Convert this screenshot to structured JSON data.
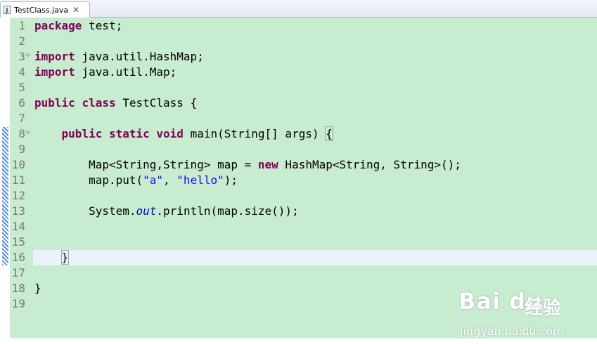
{
  "tab": {
    "title": "TestClass.java",
    "icon": "J",
    "close": "✕"
  },
  "lines": [
    {
      "no": "1",
      "tokens": [
        {
          "t": "package",
          "k": "kw"
        },
        {
          "t": " test;"
        }
      ]
    },
    {
      "no": "2",
      "tokens": []
    },
    {
      "no": "3",
      "fold": "⊖",
      "tokens": [
        {
          "t": "import",
          "k": "kw"
        },
        {
          "t": " java.util.HashMap;"
        }
      ]
    },
    {
      "no": "4",
      "tokens": [
        {
          "t": "import",
          "k": "kw"
        },
        {
          "t": " java.util.Map;"
        }
      ]
    },
    {
      "no": "5",
      "tokens": []
    },
    {
      "no": "6",
      "tokens": [
        {
          "t": "public",
          "k": "kw"
        },
        {
          "t": " "
        },
        {
          "t": "class",
          "k": "kw"
        },
        {
          "t": " TestClass {"
        }
      ]
    },
    {
      "no": "7",
      "tokens": []
    },
    {
      "no": "8",
      "fold": "⊖",
      "tokens": [
        {
          "t": "    "
        },
        {
          "t": "public",
          "k": "kw"
        },
        {
          "t": " "
        },
        {
          "t": "static",
          "k": "kw"
        },
        {
          "t": " "
        },
        {
          "t": "void",
          "k": "kw"
        },
        {
          "t": " main(String[] args) "
        },
        {
          "t": "{",
          "k": "bracket-box"
        }
      ]
    },
    {
      "no": "9",
      "tokens": []
    },
    {
      "no": "10",
      "tokens": [
        {
          "t": "        Map<String,String> map = "
        },
        {
          "t": "new",
          "k": "kw"
        },
        {
          "t": " HashMap<String, String>();"
        }
      ]
    },
    {
      "no": "11",
      "tokens": [
        {
          "t": "        map.put("
        },
        {
          "t": "\"a\"",
          "k": "str"
        },
        {
          "t": ", "
        },
        {
          "t": "\"hello\"",
          "k": "str"
        },
        {
          "t": ");"
        }
      ]
    },
    {
      "no": "12",
      "tokens": []
    },
    {
      "no": "13",
      "tokens": [
        {
          "t": "        System."
        },
        {
          "t": "out",
          "k": "field"
        },
        {
          "t": ".println(map.size());"
        }
      ]
    },
    {
      "no": "14",
      "tokens": []
    },
    {
      "no": "15",
      "tokens": []
    },
    {
      "no": "16",
      "current": true,
      "tokens": [
        {
          "t": "    "
        },
        {
          "t": "}",
          "k": "bracket-box"
        }
      ]
    },
    {
      "no": "17",
      "tokens": []
    },
    {
      "no": "18",
      "tokens": [
        {
          "t": "}"
        }
      ]
    },
    {
      "no": "19",
      "tokens": []
    }
  ],
  "watermark": {
    "logo": "Bai du",
    "cn": "经验",
    "url": "jingyan.baidu.com"
  },
  "colors": {
    "background": "#c8ecd0",
    "keyword": "#7f0055",
    "string": "#2a00ff",
    "field": "#0000c0",
    "current_line": "#eaf3fb"
  }
}
